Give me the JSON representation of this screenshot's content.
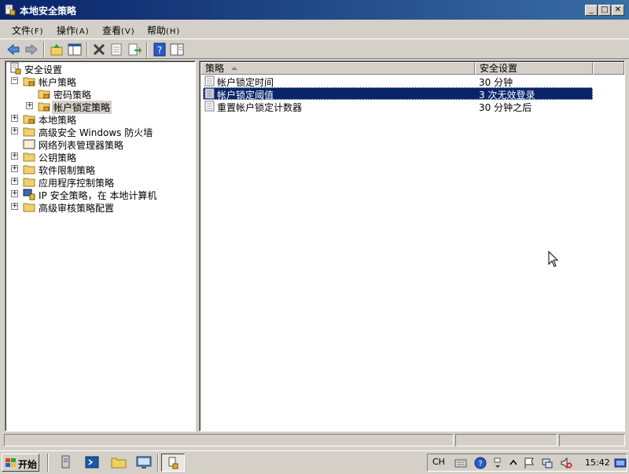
{
  "window": {
    "title": "本地安全策略"
  },
  "menu": [
    {
      "label": "文件",
      "accel": "(F)"
    },
    {
      "label": "操作",
      "accel": "(A)"
    },
    {
      "label": "查看",
      "accel": "(V)"
    },
    {
      "label": "帮助",
      "accel": "(H)"
    }
  ],
  "tree": {
    "root": "安全设置",
    "items": [
      {
        "label": "帐户策略",
        "expander": "−"
      },
      {
        "label": "密码策略",
        "expander": ""
      },
      {
        "label": "帐户锁定策略",
        "expander": "+"
      },
      {
        "label": "本地策略",
        "expander": "+"
      },
      {
        "label": "高级安全 Windows 防火墙",
        "expander": "+"
      },
      {
        "label": "网络列表管理器策略",
        "expander": ""
      },
      {
        "label": "公钥策略",
        "expander": "+"
      },
      {
        "label": "软件限制策略",
        "expander": "+"
      },
      {
        "label": "应用程序控制策略",
        "expander": "+"
      },
      {
        "label": "IP 安全策略，在 本地计算机",
        "expander": "+"
      },
      {
        "label": "高级审核策略配置",
        "expander": "+"
      }
    ]
  },
  "list": {
    "columns": [
      "策略",
      "安全设置"
    ],
    "rows": [
      {
        "name": "帐户锁定时间",
        "value": "30 分钟"
      },
      {
        "name": "帐户锁定阈值",
        "value": "3 次无效登录"
      },
      {
        "name": "重置帐户锁定计数器",
        "value": "30 分钟之后"
      }
    ]
  },
  "taskbar": {
    "start_label": "开始",
    "lang": "CH",
    "clock": "15:42"
  },
  "colors": {
    "title_start": "#0a246a",
    "title_end": "#3a6ea5",
    "selection": "#0a246a",
    "chrome": "#d4d0c8"
  }
}
